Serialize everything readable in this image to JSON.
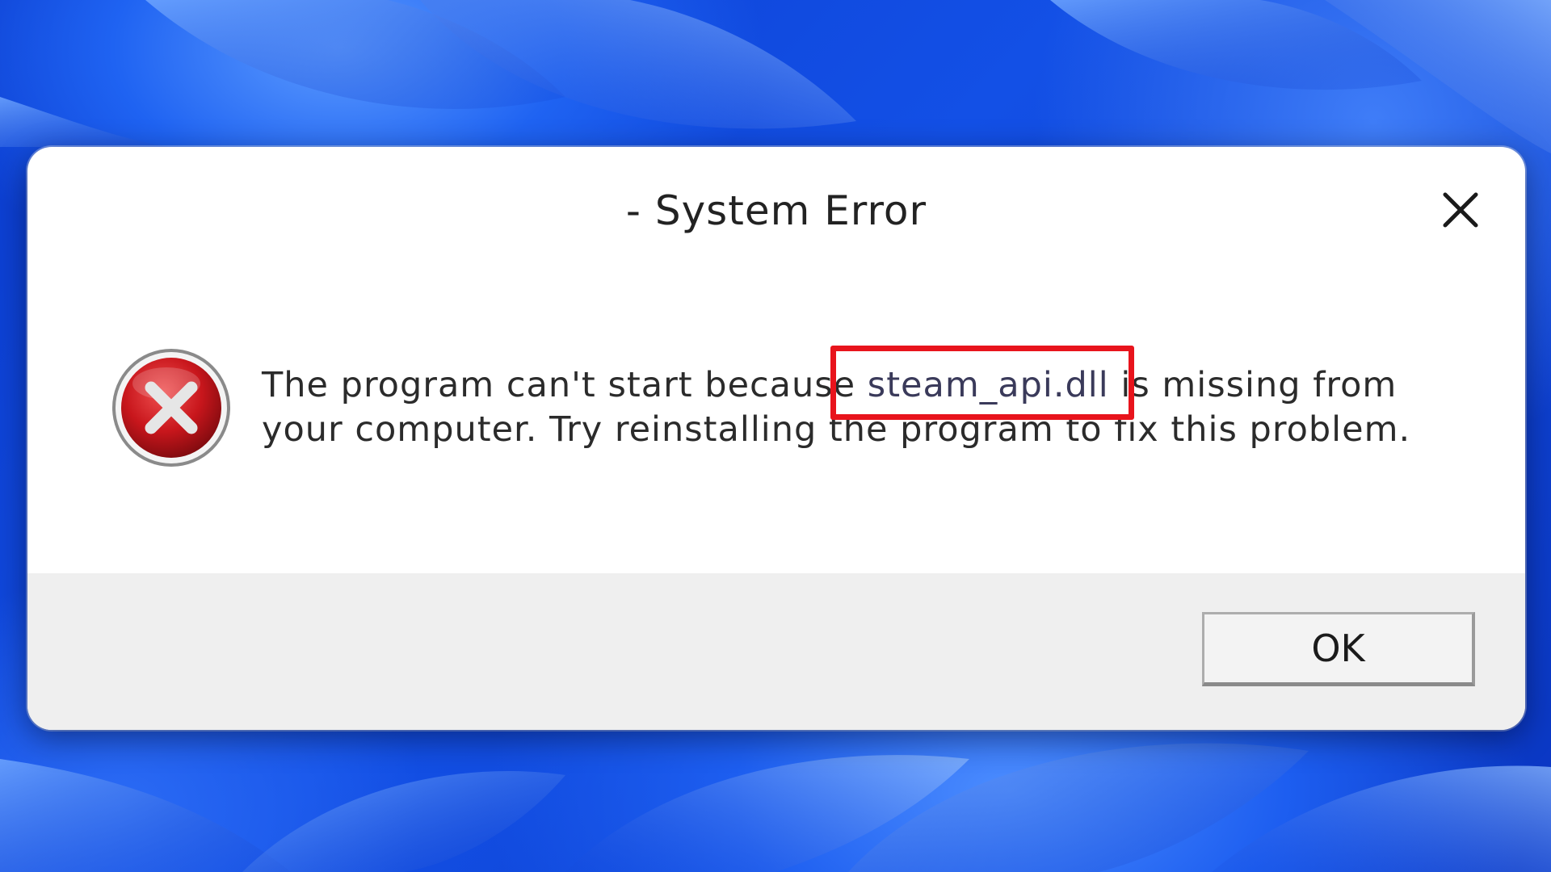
{
  "desktop": {
    "wallpaper": "Windows 11 blue bloom"
  },
  "dialog": {
    "title": "- System Error",
    "icon": "error-icon",
    "message_part1": "The program can't start because ",
    "dll_name": "steam_api.dll",
    "message_part2": " is missing from",
    "message_line2": "your computer. Try reinstalling the program to fix this problem.",
    "ok_label": "OK",
    "close_icon": "close-icon"
  },
  "colors": {
    "highlight": "#e8141c",
    "error_red": "#c8161c",
    "dialog_bg": "#ffffff",
    "footer_bg": "#efefef"
  }
}
